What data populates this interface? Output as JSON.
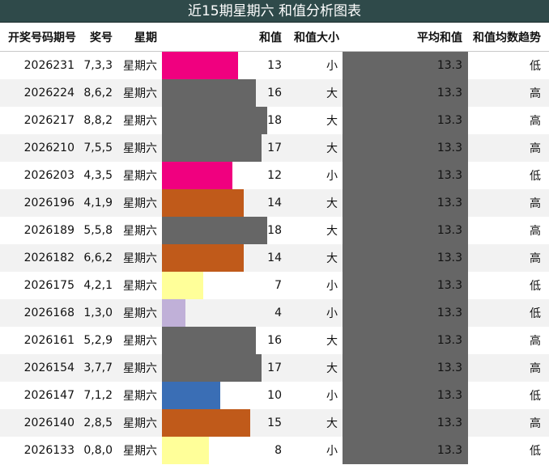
{
  "title": "近15期星期六 和值分析图表",
  "headers": {
    "issue": "开奖号码期号",
    "numbers": "奖号",
    "weekday": "星期",
    "sum": "和值",
    "size": "和值大小",
    "avg": "平均和值",
    "trend": "和值均数趋势"
  },
  "sum_scale_max": 21,
  "rows": [
    {
      "issue": "2026231",
      "numbers": "7,3,3",
      "weekday": "星期六",
      "sum": "13",
      "sum_value": 13,
      "bar_color": "#f0007f",
      "size": "小",
      "avg": "13.3",
      "trend": "低"
    },
    {
      "issue": "2026224",
      "numbers": "8,6,2",
      "weekday": "星期六",
      "sum": "16",
      "sum_value": 16,
      "bar_color": "#666666",
      "size": "大",
      "avg": "13.3",
      "trend": "高"
    },
    {
      "issue": "2026217",
      "numbers": "8,8,2",
      "weekday": "星期六",
      "sum": "18",
      "sum_value": 18,
      "bar_color": "#666666",
      "size": "大",
      "avg": "13.3",
      "trend": "高"
    },
    {
      "issue": "2026210",
      "numbers": "7,5,5",
      "weekday": "星期六",
      "sum": "17",
      "sum_value": 17,
      "bar_color": "#666666",
      "size": "大",
      "avg": "13.3",
      "trend": "高"
    },
    {
      "issue": "2026203",
      "numbers": "4,3,5",
      "weekday": "星期六",
      "sum": "12",
      "sum_value": 12,
      "bar_color": "#f0007f",
      "size": "小",
      "avg": "13.3",
      "trend": "低"
    },
    {
      "issue": "2026196",
      "numbers": "4,1,9",
      "weekday": "星期六",
      "sum": "14",
      "sum_value": 14,
      "bar_color": "#c05a1a",
      "size": "大",
      "avg": "13.3",
      "trend": "高"
    },
    {
      "issue": "2026189",
      "numbers": "5,5,8",
      "weekday": "星期六",
      "sum": "18",
      "sum_value": 18,
      "bar_color": "#666666",
      "size": "大",
      "avg": "13.3",
      "trend": "高"
    },
    {
      "issue": "2026182",
      "numbers": "6,6,2",
      "weekday": "星期六",
      "sum": "14",
      "sum_value": 14,
      "bar_color": "#c05a1a",
      "size": "大",
      "avg": "13.3",
      "trend": "高"
    },
    {
      "issue": "2026175",
      "numbers": "4,2,1",
      "weekday": "星期六",
      "sum": "7",
      "sum_value": 7,
      "bar_color": "#ffff99",
      "size": "小",
      "avg": "13.3",
      "trend": "低"
    },
    {
      "issue": "2026168",
      "numbers": "1,3,0",
      "weekday": "星期六",
      "sum": "4",
      "sum_value": 4,
      "bar_color": "#c0b0d8",
      "size": "小",
      "avg": "13.3",
      "trend": "低"
    },
    {
      "issue": "2026161",
      "numbers": "5,2,9",
      "weekday": "星期六",
      "sum": "16",
      "sum_value": 16,
      "bar_color": "#666666",
      "size": "大",
      "avg": "13.3",
      "trend": "高"
    },
    {
      "issue": "2026154",
      "numbers": "3,7,7",
      "weekday": "星期六",
      "sum": "17",
      "sum_value": 17,
      "bar_color": "#666666",
      "size": "大",
      "avg": "13.3",
      "trend": "高"
    },
    {
      "issue": "2026147",
      "numbers": "7,1,2",
      "weekday": "星期六",
      "sum": "10",
      "sum_value": 10,
      "bar_color": "#3a6eb5",
      "size": "小",
      "avg": "13.3",
      "trend": "低"
    },
    {
      "issue": "2026140",
      "numbers": "2,8,5",
      "weekday": "星期六",
      "sum": "15",
      "sum_value": 15,
      "bar_color": "#c05a1a",
      "size": "大",
      "avg": "13.3",
      "trend": "高"
    },
    {
      "issue": "2026133",
      "numbers": "0,8,0",
      "weekday": "星期六",
      "sum": "8",
      "sum_value": 8,
      "bar_color": "#ffff99",
      "size": "小",
      "avg": "13.3",
      "trend": "低"
    }
  ]
}
